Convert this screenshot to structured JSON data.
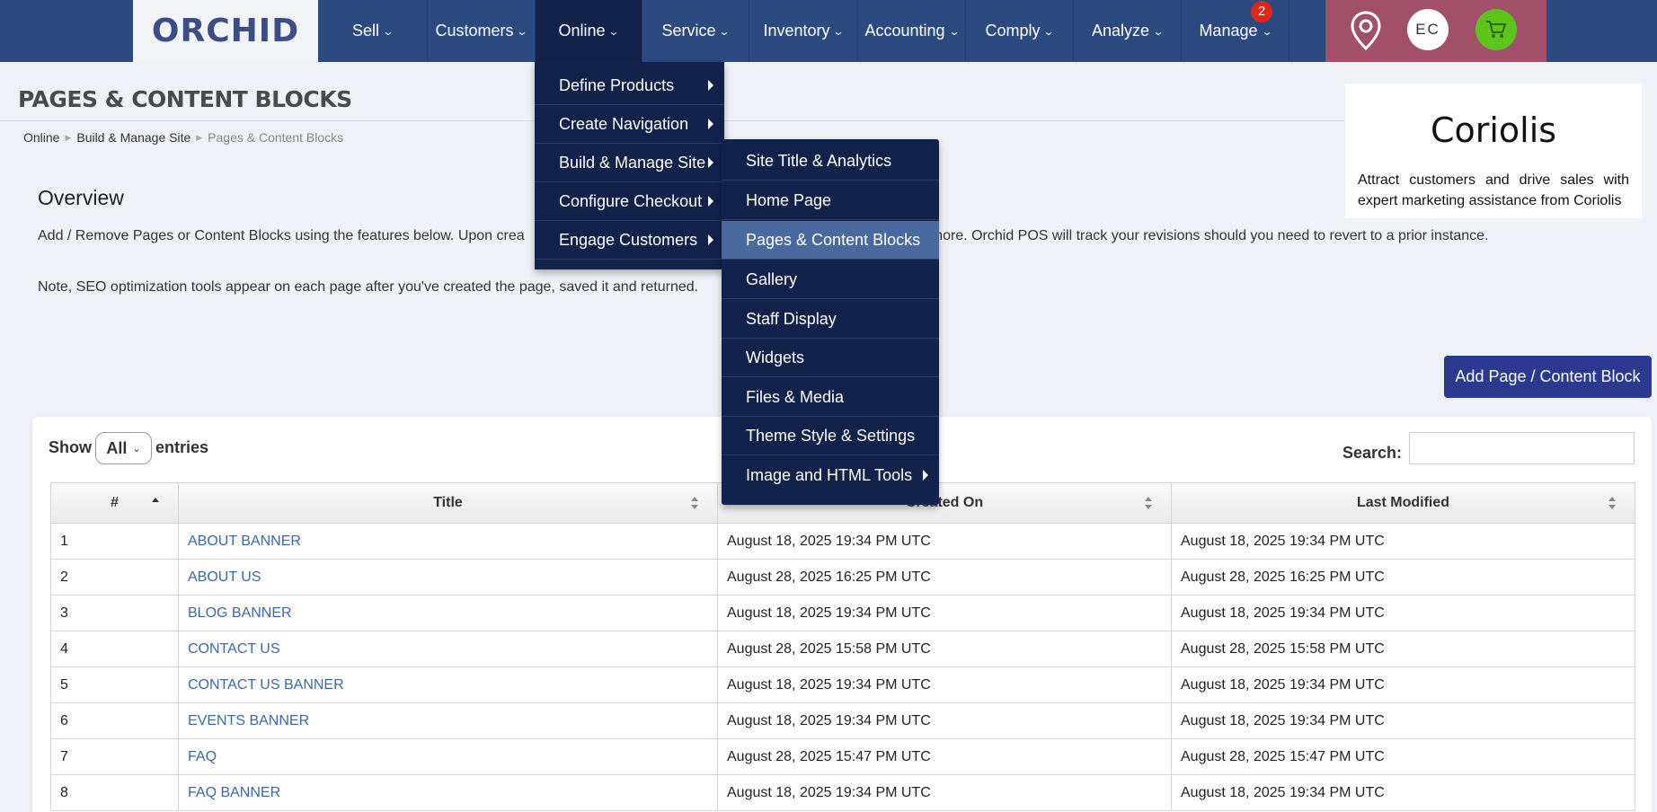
{
  "brand": {
    "logo_text": "ORCHID"
  },
  "nav": {
    "items": [
      {
        "label": "Sell"
      },
      {
        "label": "Customers"
      },
      {
        "label": "Online"
      },
      {
        "label": "Service"
      },
      {
        "label": "Inventory"
      },
      {
        "label": "Accounting"
      },
      {
        "label": "Comply"
      },
      {
        "label": "Analyze"
      },
      {
        "label": "Manage"
      }
    ],
    "manage_badge": "2",
    "user_initials": "EC"
  },
  "page": {
    "title": "PAGES & CONTENT BLOCKS",
    "breadcrumb": [
      "Online",
      "Build & Manage Site",
      "Pages & Content Blocks"
    ]
  },
  "promo": {
    "title": "Coriolis",
    "text": "Attract customers and drive sales with expert marketing assistance from Coriolis"
  },
  "overview": {
    "heading": "Overview",
    "paragraph_start": "Add / Remove Pages or Content Blocks using the features below. Upon crea",
    "paragraph_end": " a title, content, images and more. Orchid POS will track your revisions should you need to revert to a prior instance.",
    "note": "Note, SEO optimization tools appear on each page after you've created the page, saved it and returned."
  },
  "actions": {
    "add_button": "Add Page / Content Block"
  },
  "table_controls": {
    "show_label": "Show",
    "show_value": "All",
    "entries_label": "entries",
    "search_label": "Search:",
    "search_value": ""
  },
  "table": {
    "headers": [
      "#",
      "Title",
      "Created On",
      "Last Modified"
    ],
    "rows": [
      [
        "1",
        "ABOUT BANNER",
        "August 18, 2025 19:34 PM UTC",
        "August 18, 2025 19:34 PM UTC"
      ],
      [
        "2",
        "ABOUT US",
        "August 28, 2025 16:25 PM UTC",
        "August 28, 2025 16:25 PM UTC"
      ],
      [
        "3",
        "BLOG BANNER",
        "August 18, 2025 19:34 PM UTC",
        "August 18, 2025 19:34 PM UTC"
      ],
      [
        "4",
        "CONTACT US",
        "August 28, 2025 15:58 PM UTC",
        "August 28, 2025 15:58 PM UTC"
      ],
      [
        "5",
        "CONTACT US BANNER",
        "August 18, 2025 19:34 PM UTC",
        "August 18, 2025 19:34 PM UTC"
      ],
      [
        "6",
        "EVENTS BANNER",
        "August 18, 2025 19:34 PM UTC",
        "August 18, 2025 19:34 PM UTC"
      ],
      [
        "7",
        "FAQ",
        "August 28, 2025 15:47 PM UTC",
        "August 28, 2025 15:47 PM UTC"
      ],
      [
        "8",
        "FAQ BANNER",
        "August 18, 2025 19:34 PM UTC",
        "August 18, 2025 19:34 PM UTC"
      ]
    ]
  },
  "online_menu": {
    "items": [
      {
        "label": "Define Products"
      },
      {
        "label": "Create Navigation"
      },
      {
        "label": "Build & Manage Site"
      },
      {
        "label": "Configure Checkout"
      },
      {
        "label": "Engage Customers"
      }
    ]
  },
  "build_submenu": {
    "items": [
      {
        "label": "Site Title & Analytics"
      },
      {
        "label": "Home Page"
      },
      {
        "label": "Pages & Content Blocks"
      },
      {
        "label": "Gallery"
      },
      {
        "label": "Staff Display"
      },
      {
        "label": "Widgets"
      },
      {
        "label": "Files & Media"
      },
      {
        "label": "Theme Style & Settings"
      },
      {
        "label": "Image and HTML Tools"
      }
    ]
  },
  "colors": {
    "nav_bg": "#2c4a7f",
    "menu_bg": "#12224a",
    "menu_highlight": "#4a6a9e",
    "button_bg": "#2b3990",
    "link": "#3a6aa8",
    "badge": "#e0261b",
    "cart": "#5cc41a"
  }
}
